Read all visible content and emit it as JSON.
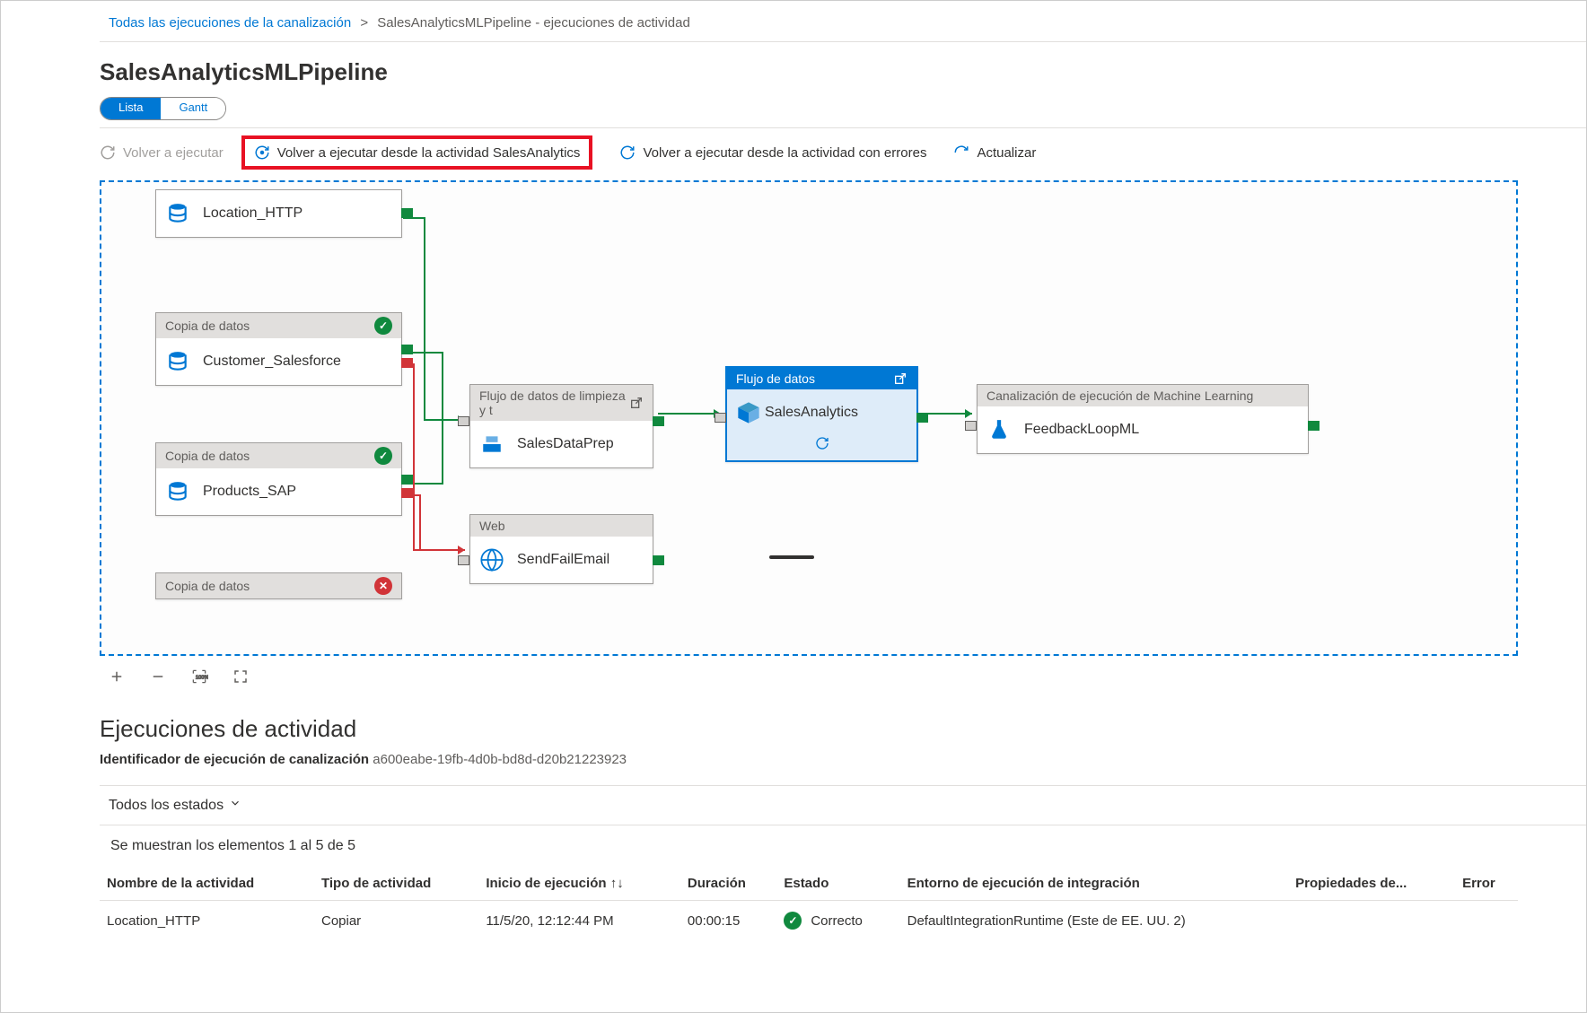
{
  "breadcrumb": {
    "root": "Todas las ejecuciones de la canalización",
    "current": "SalesAnalyticsMLPipeline - ejecuciones de actividad"
  },
  "page_title": "SalesAnalyticsMLPipeline",
  "view_toggle": {
    "lista": "Lista",
    "gantt": "Gantt"
  },
  "toolbar": {
    "rerun": "Volver a ejecutar",
    "rerun_from_activity": "Volver a ejecutar desde la actividad SalesAnalytics",
    "rerun_failed": "Volver a ejecutar desde la actividad con errores",
    "refresh": "Actualizar"
  },
  "activities": {
    "location_http": {
      "header": "",
      "name": "Location_HTTP"
    },
    "customer_sf": {
      "header": "Copia de datos",
      "name": "Customer_Salesforce",
      "status": "success"
    },
    "products_sap": {
      "header": "Copia de datos",
      "name": "Products_SAP",
      "status": "success"
    },
    "copy4": {
      "header": "Copia de datos",
      "status": "fail"
    },
    "salesdataprep": {
      "header": "Flujo de datos de limpieza y t",
      "name": "SalesDataPrep"
    },
    "sendfailemail": {
      "header": "Web",
      "name": "SendFailEmail"
    },
    "salesanalytics": {
      "header": "Flujo de datos",
      "name": "SalesAnalytics"
    },
    "feedbackloopml": {
      "header": "Canalización de ejecución de Machine Learning",
      "name": "FeedbackLoopML"
    }
  },
  "runs_section": {
    "title": "Ejecuciones de actividad",
    "run_id_label": "Identificador de ejecución de canalización",
    "run_id": "a600eabe-19fb-4d0b-bd8d-d20b21223923",
    "filter_all": "Todos los estados",
    "showing": "Se muestran los elementos 1 al 5 de 5"
  },
  "table": {
    "headers": {
      "name": "Nombre de la actividad",
      "type": "Tipo de actividad",
      "start": "Inicio de ejecución",
      "duration": "Duración",
      "status": "Estado",
      "ir": "Entorno de ejecución de integración",
      "props": "Propiedades de...",
      "error": "Error"
    },
    "rows": [
      {
        "name": "Location_HTTP",
        "type": "Copiar",
        "start": "11/5/20, 12:12:44 PM",
        "duration": "00:00:15",
        "status": "Correcto",
        "ir": "DefaultIntegrationRuntime (Este de EE. UU. 2)"
      }
    ]
  }
}
